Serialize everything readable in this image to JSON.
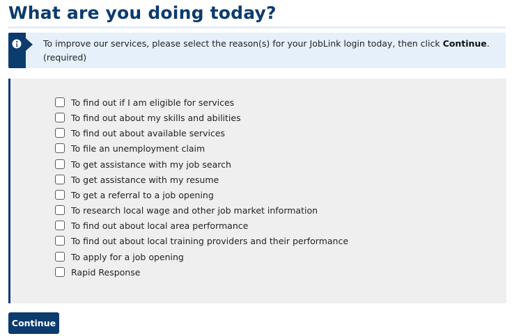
{
  "page": {
    "title": "What are you doing today?"
  },
  "info": {
    "icon": "info-icon",
    "text_before": "To improve our services, please select the reason(s) for your JobLink login today, then click ",
    "emphasis": "Continue",
    "text_after": ". (required)"
  },
  "options": [
    {
      "label": "To find out if I am eligible for services",
      "checked": false
    },
    {
      "label": "To find out about my skills and abilities",
      "checked": false
    },
    {
      "label": "To find out about available services",
      "checked": false
    },
    {
      "label": "To file an unemployment claim",
      "checked": false
    },
    {
      "label": "To get assistance with my job search",
      "checked": false
    },
    {
      "label": "To get assistance with my resume",
      "checked": false
    },
    {
      "label": "To get a referral to a job opening",
      "checked": false
    },
    {
      "label": "To research local wage and other job market information",
      "checked": false
    },
    {
      "label": "To find out about local area performance",
      "checked": false
    },
    {
      "label": "To find out about local training providers and their performance",
      "checked": false
    },
    {
      "label": "To apply for a job opening",
      "checked": false
    },
    {
      "label": "Rapid Response",
      "checked": false
    }
  ],
  "actions": {
    "continue_label": "Continue"
  },
  "colors": {
    "primary": "#0c3b6e",
    "info_bg": "#e6f0fa",
    "panel_bg": "#efefef"
  }
}
